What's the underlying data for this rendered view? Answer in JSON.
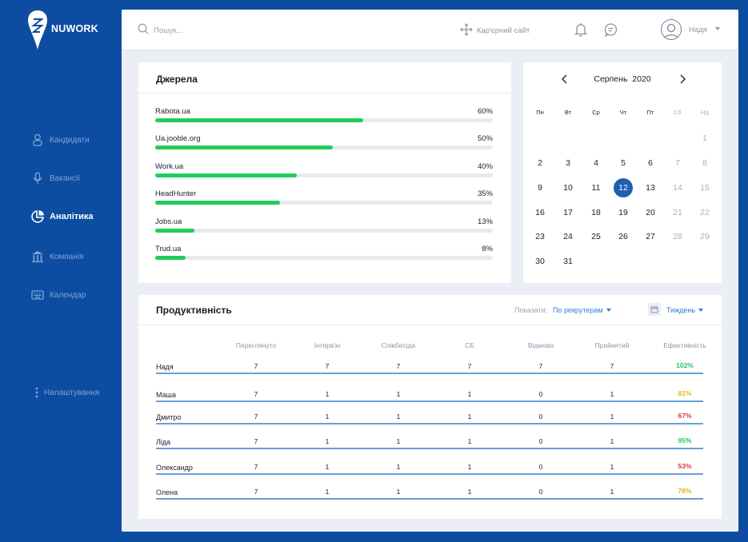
{
  "brand": {
    "name": "NUWORK"
  },
  "sidebar": {
    "items": [
      {
        "label": "Кандидати",
        "icon": "user-icon",
        "active": false
      },
      {
        "label": "Вакансії",
        "icon": "microphone-icon",
        "active": false
      },
      {
        "label": "Аналітика",
        "icon": "pie-chart-icon",
        "active": true
      },
      {
        "label": "Компанія",
        "icon": "bank-icon",
        "active": false
      },
      {
        "label": "Календар",
        "icon": "keyboard-icon",
        "active": false
      }
    ],
    "settings_label": "Налаштування"
  },
  "topbar": {
    "search_placeholder": "Пошук...",
    "career_site_label": "Кар'єрний сайт",
    "user_name": "Надя"
  },
  "sources": {
    "title": "Джерела",
    "items": [
      {
        "name": "Rabota.ua",
        "percent": "60%",
        "fill": 0.615
      },
      {
        "name": "Ua.jooble.org",
        "percent": "50%",
        "fill": 0.525
      },
      {
        "name": "Work.ua",
        "percent": "40%",
        "fill": 0.42
      },
      {
        "name": "HeadHunter",
        "percent": "35%",
        "fill": 0.37
      },
      {
        "name": "Jobs.ua",
        "percent": "13%",
        "fill": 0.115
      },
      {
        "name": "Trud.ua",
        "percent": "8%",
        "fill": 0.09
      }
    ]
  },
  "calendar": {
    "month": "Серпень",
    "year": "2020",
    "weekdays": [
      "Пн",
      "Вт",
      "Ср",
      "Чт",
      "Пт",
      "Сб",
      "Нд"
    ],
    "selected_day": 12,
    "weeks": [
      [
        null,
        null,
        null,
        null,
        null,
        null,
        1
      ],
      [
        2,
        3,
        4,
        5,
        6,
        7,
        8
      ],
      [
        9,
        10,
        11,
        12,
        13,
        14,
        15
      ],
      [
        16,
        17,
        18,
        19,
        20,
        21,
        22
      ],
      [
        23,
        24,
        25,
        26,
        27,
        28,
        29
      ],
      [
        30,
        31,
        null,
        null,
        null,
        null,
        null
      ]
    ]
  },
  "productivity": {
    "title": "Продуктивність",
    "show_label": "Показати:",
    "show_value": "По рекрутерам",
    "period_value": "Тиждень",
    "columns": [
      "Переглянуто",
      "Інтерв'ю",
      "Співбесіда",
      "СБ",
      "Відмова",
      "Прийнятий",
      "Ефективність"
    ],
    "rows": [
      {
        "name": "Надя",
        "values": [
          "7",
          "7",
          "7",
          "7",
          "7",
          "7"
        ],
        "eff": "102%",
        "eff_color": "#22c55e"
      },
      {
        "name": "Маша",
        "values": [
          "7",
          "1",
          "1",
          "1",
          "0",
          "1"
        ],
        "eff": "81%",
        "eff_color": "#e9b320"
      },
      {
        "name": "Дмитро",
        "values": [
          "7",
          "1",
          "1",
          "1",
          "0",
          "1"
        ],
        "eff": "67%",
        "eff_color": "#d93a3a"
      },
      {
        "name": "Ліда",
        "values": [
          "7",
          "1",
          "1",
          "1",
          "0",
          "1"
        ],
        "eff": "95%",
        "eff_color": "#22c55e"
      },
      {
        "name": "Олександр",
        "values": [
          "7",
          "1",
          "1",
          "1",
          "0",
          "1"
        ],
        "eff": "53%",
        "eff_color": "#d93a3a"
      },
      {
        "name": "Олена",
        "values": [
          "7",
          "1",
          "1",
          "1",
          "0",
          "1"
        ],
        "eff": "78%",
        "eff_color": "#e9b320"
      }
    ]
  },
  "colors": {
    "brand_blue": "#0d4da1",
    "accent_green": "#22cc5c",
    "selected_day": "#1e5fae",
    "link_blue": "#2d7fd6"
  }
}
